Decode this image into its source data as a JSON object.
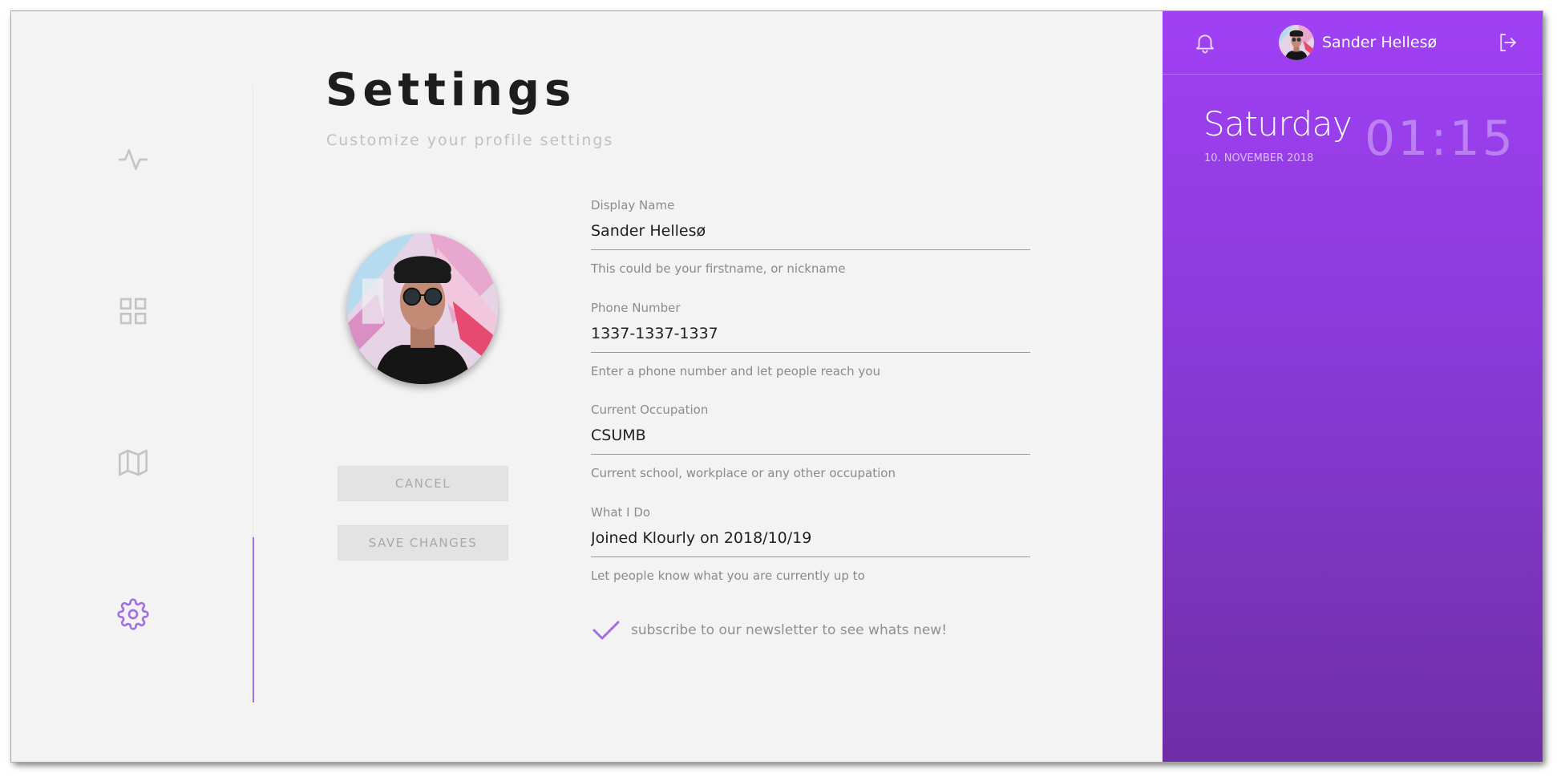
{
  "page": {
    "title": "Settings",
    "subtitle": "Customize your profile settings"
  },
  "nav": {
    "items": [
      {
        "icon": "activity-icon",
        "active": false
      },
      {
        "icon": "grid-icon",
        "active": false
      },
      {
        "icon": "map-icon",
        "active": false
      },
      {
        "icon": "gear-icon",
        "active": true
      }
    ]
  },
  "form": {
    "display_name": {
      "label": "Display Name",
      "value": "Sander Hellesø",
      "help": "This could be your firstname, or nickname"
    },
    "phone": {
      "label": "Phone Number",
      "value": "1337-1337-1337",
      "help": "Enter a phone number and let people reach you"
    },
    "occupation": {
      "label": "Current Occupation",
      "value": "CSUMB",
      "help": "Current school, workplace or any other occupation"
    },
    "what_i_do": {
      "label": "What I Do",
      "value": "Joined Klourly on 2018/10/19",
      "help": "Let people know what you are currently up to"
    },
    "newsletter": {
      "label": "subscribe to our newsletter to see whats new!",
      "checked": true
    }
  },
  "buttons": {
    "cancel": "CANCEL",
    "save": "SAVE CHANGES"
  },
  "sidebar": {
    "user_name": "Sander Hellesø",
    "day": "Saturday",
    "date": "10. NOVEMBER 2018",
    "time": "01:15"
  },
  "colors": {
    "accent": "#a070e0",
    "panel_top": "#a040f5",
    "panel_bottom": "#6e2ea6"
  }
}
